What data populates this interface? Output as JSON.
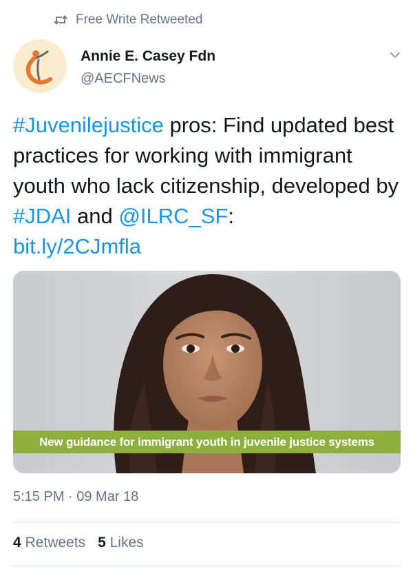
{
  "retweet_context": {
    "text": "Free Write Retweeted",
    "icon": "retweet-icon"
  },
  "author": {
    "name": "Annie E. Casey Fdn",
    "handle": "@AECFNews",
    "avatar_icon": "aecf-logo"
  },
  "tweet": {
    "hashtag1": "#Juvenilejustice",
    "text1": " pros: Find updated best practices for working with immigrant youth who lack citizenship, developed by ",
    "hashtag2": "#JDAI",
    "text2": " and ",
    "mention": "@ILRC_SF",
    "text3": ":",
    "link": "bit.ly/2CJmfla"
  },
  "media": {
    "caption": "New guidance for immigrant youth in juvenile justice systems"
  },
  "timestamp": "5:15 PM · 09 Mar 18",
  "stats": {
    "retweets_count": "4",
    "retweets_label": "Retweets",
    "likes_count": "5",
    "likes_label": "Likes"
  },
  "colors": {
    "link": "#1b95e0",
    "secondary_text": "#657786",
    "caption_bar": "#8cb03b",
    "logo_orange": "#e8762d"
  }
}
